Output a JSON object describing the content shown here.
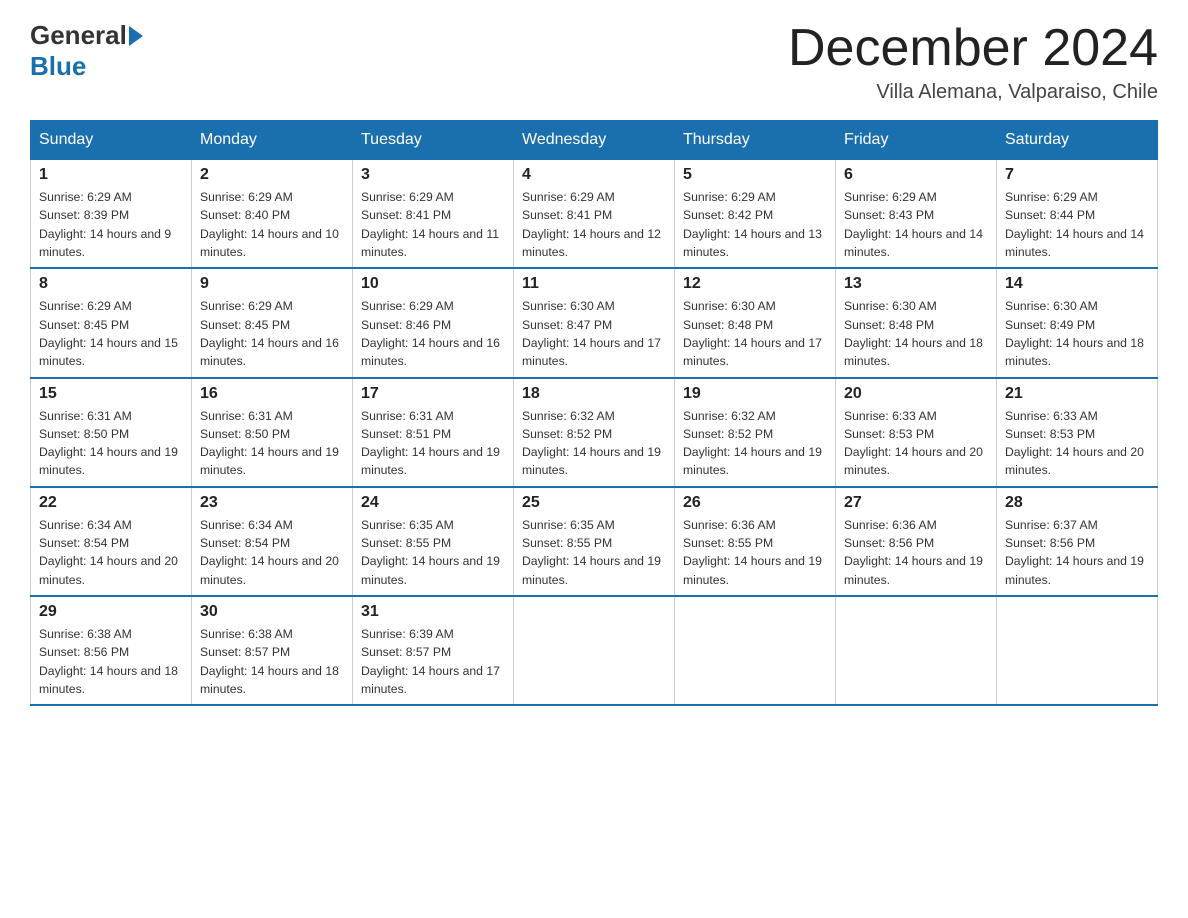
{
  "logo": {
    "general": "General",
    "blue": "Blue"
  },
  "title": "December 2024",
  "location": "Villa Alemana, Valparaiso, Chile",
  "weekdays": [
    "Sunday",
    "Monday",
    "Tuesday",
    "Wednesday",
    "Thursday",
    "Friday",
    "Saturday"
  ],
  "weeks": [
    [
      {
        "day": "1",
        "sunrise": "6:29 AM",
        "sunset": "8:39 PM",
        "daylight": "14 hours and 9 minutes."
      },
      {
        "day": "2",
        "sunrise": "6:29 AM",
        "sunset": "8:40 PM",
        "daylight": "14 hours and 10 minutes."
      },
      {
        "day": "3",
        "sunrise": "6:29 AM",
        "sunset": "8:41 PM",
        "daylight": "14 hours and 11 minutes."
      },
      {
        "day": "4",
        "sunrise": "6:29 AM",
        "sunset": "8:41 PM",
        "daylight": "14 hours and 12 minutes."
      },
      {
        "day": "5",
        "sunrise": "6:29 AM",
        "sunset": "8:42 PM",
        "daylight": "14 hours and 13 minutes."
      },
      {
        "day": "6",
        "sunrise": "6:29 AM",
        "sunset": "8:43 PM",
        "daylight": "14 hours and 14 minutes."
      },
      {
        "day": "7",
        "sunrise": "6:29 AM",
        "sunset": "8:44 PM",
        "daylight": "14 hours and 14 minutes."
      }
    ],
    [
      {
        "day": "8",
        "sunrise": "6:29 AM",
        "sunset": "8:45 PM",
        "daylight": "14 hours and 15 minutes."
      },
      {
        "day": "9",
        "sunrise": "6:29 AM",
        "sunset": "8:45 PM",
        "daylight": "14 hours and 16 minutes."
      },
      {
        "day": "10",
        "sunrise": "6:29 AM",
        "sunset": "8:46 PM",
        "daylight": "14 hours and 16 minutes."
      },
      {
        "day": "11",
        "sunrise": "6:30 AM",
        "sunset": "8:47 PM",
        "daylight": "14 hours and 17 minutes."
      },
      {
        "day": "12",
        "sunrise": "6:30 AM",
        "sunset": "8:48 PM",
        "daylight": "14 hours and 17 minutes."
      },
      {
        "day": "13",
        "sunrise": "6:30 AM",
        "sunset": "8:48 PM",
        "daylight": "14 hours and 18 minutes."
      },
      {
        "day": "14",
        "sunrise": "6:30 AM",
        "sunset": "8:49 PM",
        "daylight": "14 hours and 18 minutes."
      }
    ],
    [
      {
        "day": "15",
        "sunrise": "6:31 AM",
        "sunset": "8:50 PM",
        "daylight": "14 hours and 19 minutes."
      },
      {
        "day": "16",
        "sunrise": "6:31 AM",
        "sunset": "8:50 PM",
        "daylight": "14 hours and 19 minutes."
      },
      {
        "day": "17",
        "sunrise": "6:31 AM",
        "sunset": "8:51 PM",
        "daylight": "14 hours and 19 minutes."
      },
      {
        "day": "18",
        "sunrise": "6:32 AM",
        "sunset": "8:52 PM",
        "daylight": "14 hours and 19 minutes."
      },
      {
        "day": "19",
        "sunrise": "6:32 AM",
        "sunset": "8:52 PM",
        "daylight": "14 hours and 19 minutes."
      },
      {
        "day": "20",
        "sunrise": "6:33 AM",
        "sunset": "8:53 PM",
        "daylight": "14 hours and 20 minutes."
      },
      {
        "day": "21",
        "sunrise": "6:33 AM",
        "sunset": "8:53 PM",
        "daylight": "14 hours and 20 minutes."
      }
    ],
    [
      {
        "day": "22",
        "sunrise": "6:34 AM",
        "sunset": "8:54 PM",
        "daylight": "14 hours and 20 minutes."
      },
      {
        "day": "23",
        "sunrise": "6:34 AM",
        "sunset": "8:54 PM",
        "daylight": "14 hours and 20 minutes."
      },
      {
        "day": "24",
        "sunrise": "6:35 AM",
        "sunset": "8:55 PM",
        "daylight": "14 hours and 19 minutes."
      },
      {
        "day": "25",
        "sunrise": "6:35 AM",
        "sunset": "8:55 PM",
        "daylight": "14 hours and 19 minutes."
      },
      {
        "day": "26",
        "sunrise": "6:36 AM",
        "sunset": "8:55 PM",
        "daylight": "14 hours and 19 minutes."
      },
      {
        "day": "27",
        "sunrise": "6:36 AM",
        "sunset": "8:56 PM",
        "daylight": "14 hours and 19 minutes."
      },
      {
        "day": "28",
        "sunrise": "6:37 AM",
        "sunset": "8:56 PM",
        "daylight": "14 hours and 19 minutes."
      }
    ],
    [
      {
        "day": "29",
        "sunrise": "6:38 AM",
        "sunset": "8:56 PM",
        "daylight": "14 hours and 18 minutes."
      },
      {
        "day": "30",
        "sunrise": "6:38 AM",
        "sunset": "8:57 PM",
        "daylight": "14 hours and 18 minutes."
      },
      {
        "day": "31",
        "sunrise": "6:39 AM",
        "sunset": "8:57 PM",
        "daylight": "14 hours and 17 minutes."
      },
      null,
      null,
      null,
      null
    ]
  ]
}
